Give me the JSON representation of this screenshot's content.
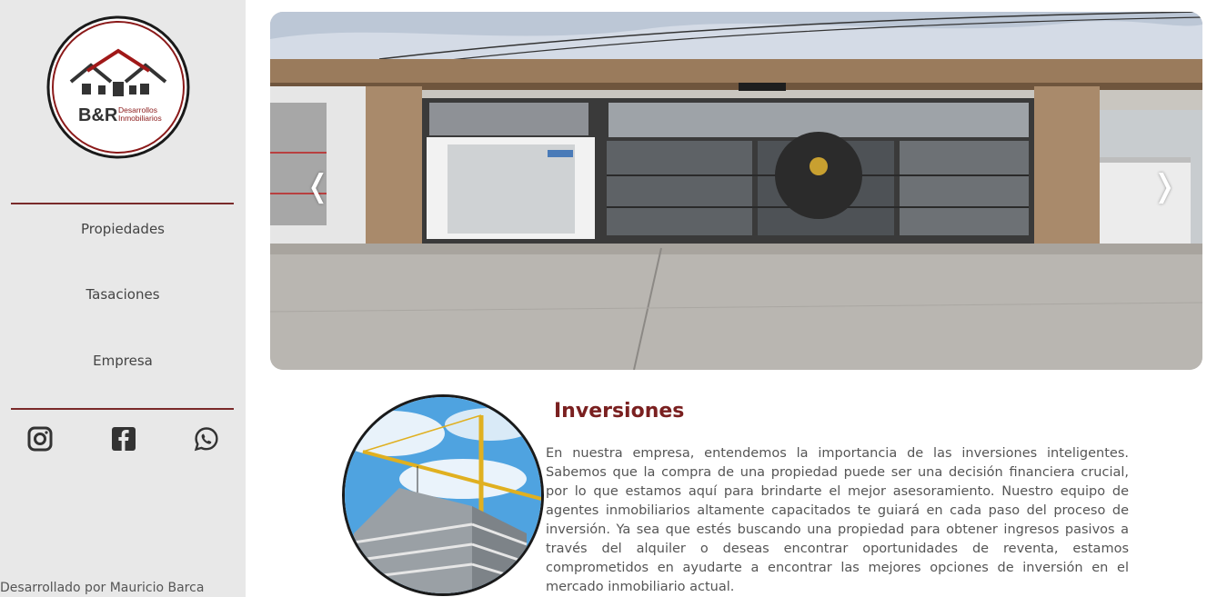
{
  "brand": {
    "logo_main": "B&R",
    "logo_sub1": "Desarrollos",
    "logo_sub2": "Inmobiliarios",
    "accent_color": "#7a2020"
  },
  "nav": {
    "items": [
      {
        "label": "Propiedades"
      },
      {
        "label": "Tasaciones"
      },
      {
        "label": "Empresa"
      }
    ]
  },
  "social": {
    "icons": [
      "instagram-icon",
      "facebook-icon",
      "whatsapp-icon"
    ]
  },
  "footer": {
    "credit": "Desarrollado por Mauricio Barca"
  },
  "carousel": {
    "prev_symbol": "❬",
    "next_symbol": "❭"
  },
  "section": {
    "title": "Inversiones",
    "body": "En nuestra empresa, entendemos la importancia de las inversiones inteligentes. Sabemos que la compra de una propiedad puede ser una decisión financiera crucial, por lo que estamos aquí para brindarte el mejor asesoramiento. Nuestro equipo de agentes inmobiliarios altamente capacitados te guiará en cada paso del proceso de inversión. Ya sea que estés buscando una propiedad para obtener ingresos pasivos a través del alquiler o deseas encontrar oportunidades de reventa, estamos comprometidos en ayudarte a encontrar las mejores opciones de inversión en el mercado inmobiliario actual."
  }
}
